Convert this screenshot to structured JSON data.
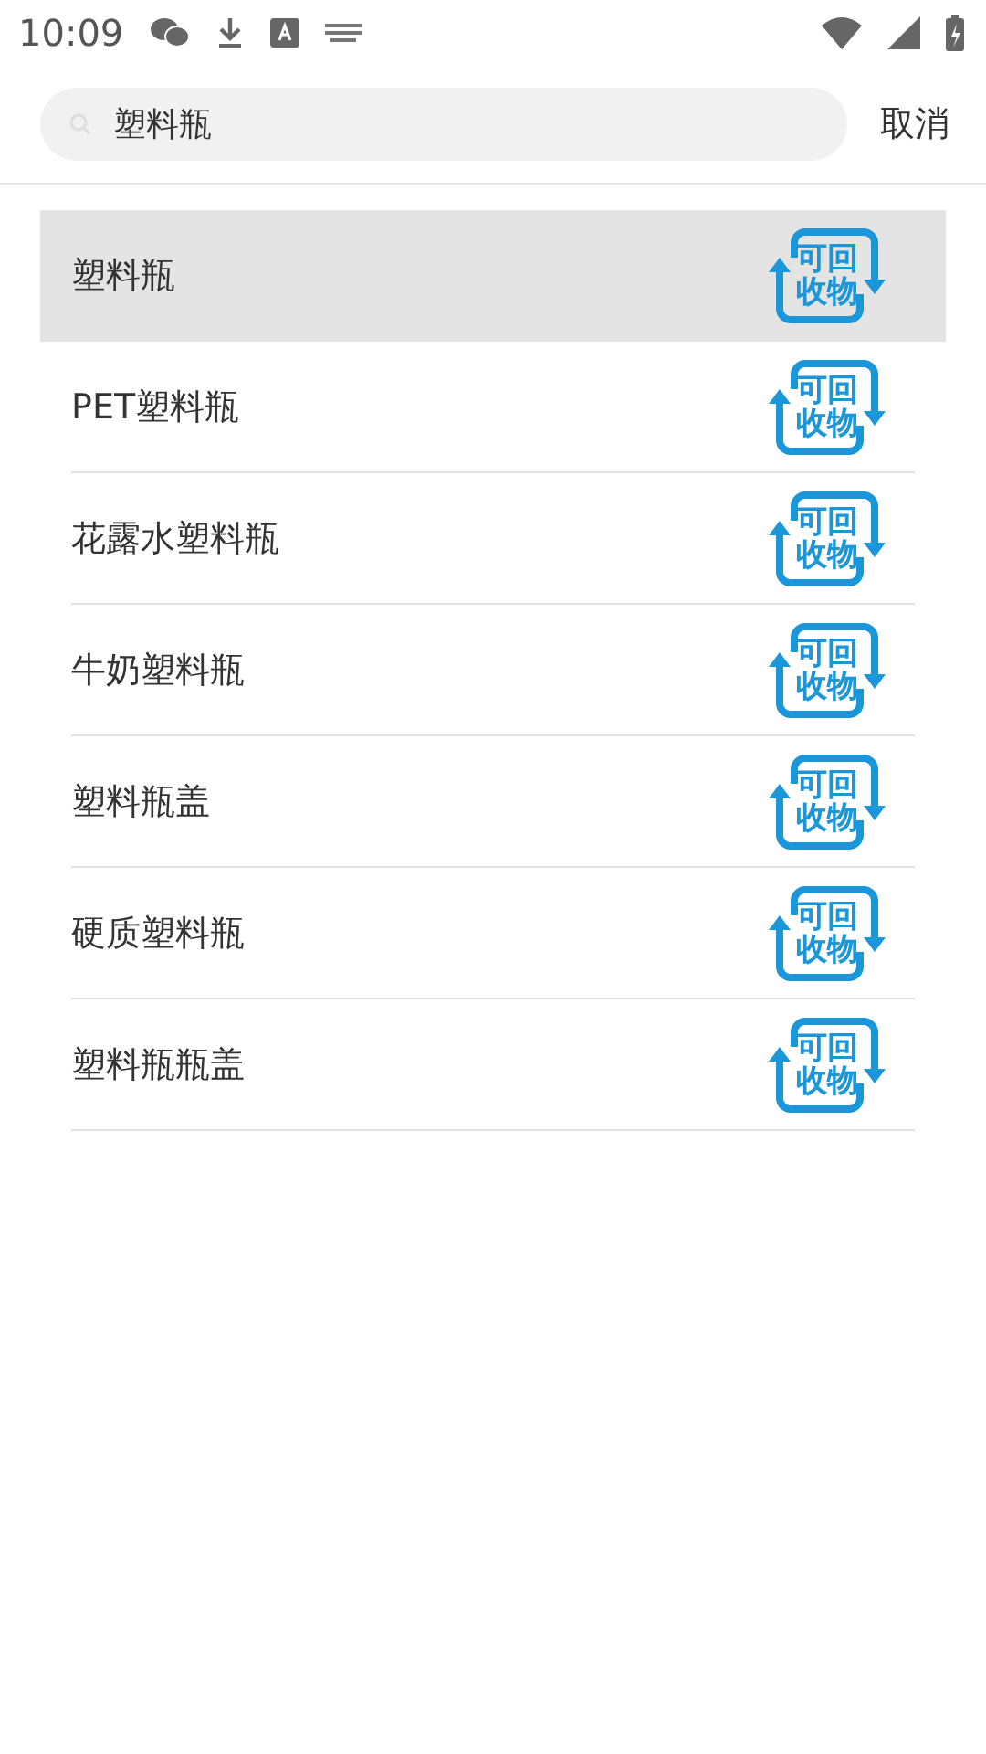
{
  "status_bar": {
    "time": "10:09"
  },
  "search": {
    "value": "塑料瓶",
    "cancel": "取消"
  },
  "results": [
    {
      "name": "塑料瓶",
      "badge": "可回收物",
      "selected": true
    },
    {
      "name": "PET塑料瓶",
      "badge": "可回收物",
      "selected": false
    },
    {
      "name": "花露水塑料瓶",
      "badge": "可回收物",
      "selected": false
    },
    {
      "name": "牛奶塑料瓶",
      "badge": "可回收物",
      "selected": false
    },
    {
      "name": "塑料瓶盖",
      "badge": "可回收物",
      "selected": false
    },
    {
      "name": "硬质塑料瓶",
      "badge": "可回收物",
      "selected": false
    },
    {
      "name": "塑料瓶瓶盖",
      "badge": "可回收物",
      "selected": false
    }
  ]
}
